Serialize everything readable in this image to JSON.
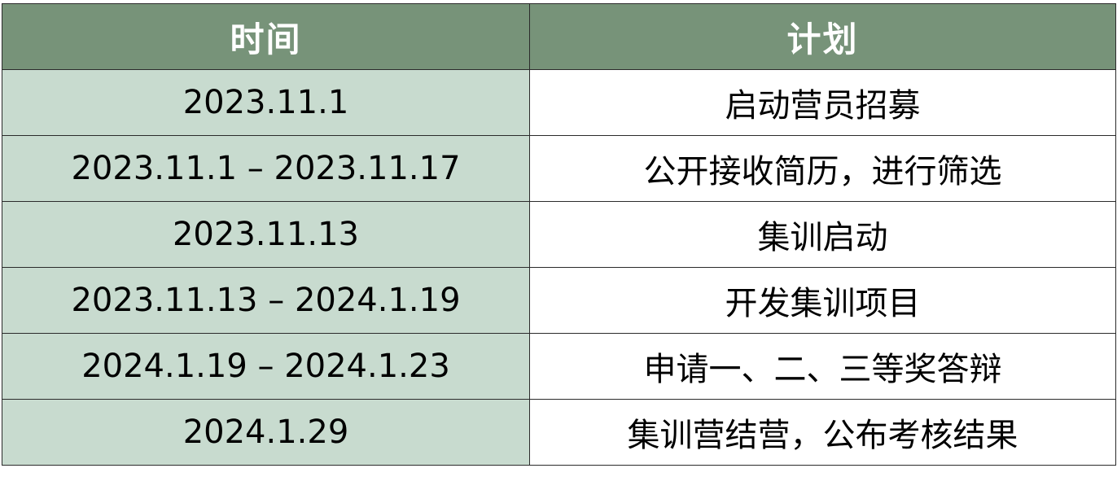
{
  "header": {
    "time": "时间",
    "plan": "计划"
  },
  "rows": [
    {
      "time": "2023.11.1",
      "plan": "启动营员招募"
    },
    {
      "time": "2023.11.1 – 2023.11.17",
      "plan": "公开接收简历，进行筛选"
    },
    {
      "time": "2023.11.13",
      "plan": "集训启动"
    },
    {
      "time": "2023.11.13 – 2024.1.19",
      "plan": "开发集训项目"
    },
    {
      "time": "2024.1.19 – 2024.1.23",
      "plan": "申请一、二、三等奖答辩"
    },
    {
      "time": "2024.1.29",
      "plan": "集训营结营，公布考核结果"
    }
  ],
  "colors": {
    "header_bg": "#779379",
    "time_col_bg": "#c8dbcf",
    "plan_col_bg": "#ffffff",
    "border": "#2b2b2b"
  }
}
